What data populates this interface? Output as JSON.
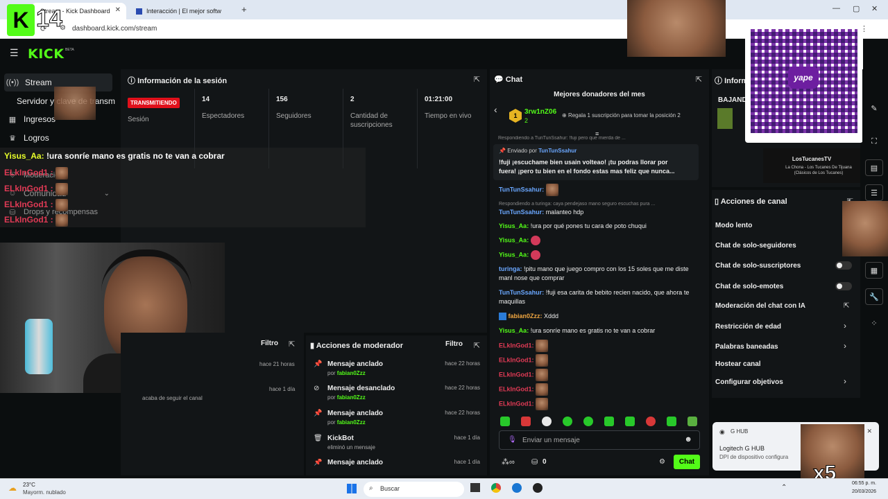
{
  "browser": {
    "tab1_title": "Stream - Kick Dashboard",
    "tab2_title": "Interacción | El mejor softw",
    "new_tab": "+",
    "url": "dashboard.kick.com/stream"
  },
  "app": {
    "logo": "KICK",
    "beta": "BETA"
  },
  "sidebar": {
    "items": [
      {
        "label": "Stream",
        "icon": "stream-icon"
      },
      {
        "label": "Servidor y clave de transm"
      },
      {
        "label": "Ingresos",
        "icon": "income-icon"
      },
      {
        "label": "Logros",
        "icon": "trophy-icon"
      },
      {
        "label": "Moderación",
        "icon": "shield-icon"
      },
      {
        "label": "Comunidad",
        "icon": "community-icon"
      },
      {
        "label": "Drops y recompensas",
        "icon": "gift-icon"
      }
    ]
  },
  "overlay": {
    "counter": "14",
    "line1_user": "Yisus_Aa:",
    "line1_text": "!ura sonríe mano es gratis no te van a cobrar",
    "elkin": "ELkInGod1 :",
    "follow_text": "acaba de seguir el canal"
  },
  "session": {
    "title": "Información de la sesión",
    "badge": "TRANSMITIENDO",
    "badge_label": "Sesión",
    "viewers": "14",
    "viewers_label": "Espectadores",
    "followers": "156",
    "followers_label": "Seguidores",
    "subs": "2",
    "subs_label": "Cantidad de suscripciones",
    "time": "01:21:00",
    "time_label": "Tiempo en vivo"
  },
  "left_lower": {
    "filter": "Filtro",
    "time1": "hace 21 horas",
    "time2": "hace 1 día"
  },
  "moderator": {
    "title": "Acciones de moderador",
    "filter": "Filtro",
    "rows": [
      {
        "title": "Mensaje anclado",
        "by_prefix": "por",
        "by": "fabian0Zzz",
        "time": "hace 22 horas"
      },
      {
        "title": "Mensaje desanclado",
        "by_prefix": "por",
        "by": "fabian0Zzz",
        "time": "hace 22 horas"
      },
      {
        "title": "Mensaje anclado",
        "by_prefix": "por",
        "by": "fabian0Zzz",
        "time": "hace 22 horas"
      },
      {
        "title": "KickBot",
        "by_prefix": "",
        "by": "eliminó un mensaje",
        "time": "hace 1 día"
      },
      {
        "title": "Mensaje anclado",
        "by_prefix": "",
        "by": "",
        "time": "hace 1 día"
      }
    ]
  },
  "chat": {
    "title": "Chat",
    "donors_title": "Mejores donadores del mes",
    "donor_name": "3rw1nZ06",
    "donor_count": "2",
    "donor_cta": "Regala 1 suscripción para tomar la posición 2",
    "reply1": "Respondiendo a TunTunSsahur: !fuji pero que mierda de ...",
    "pinned_by_label": "Enviado por",
    "pinned_by": "TunTunSsahur",
    "pinned_text": "!fuji ¡escuchame bien usain volteao! ¡tu podras llorar por fuera! ¡pero tu bien en el fondo estas mas feliz que nunca...",
    "reply2": "Respondiendo a turinga: caya pendejaso mano seguro escuchas pura ...",
    "messages": [
      {
        "user": "TunTunSsahur:",
        "text": ""
      },
      {
        "user": "TunTunSsahur:",
        "text": "malanteo hdp"
      },
      {
        "user": "Yisus_Aa:",
        "text": "!ura por qué pones tu cara de poto chuqui"
      },
      {
        "user": "Yisus_Aa:",
        "text": ""
      },
      {
        "user": "Yisus_Aa:",
        "text": ""
      },
      {
        "user": "turinga:",
        "text": "!pitu mano que juego compro con los 15 soles que me diste manl nose que comprar"
      },
      {
        "user": "TunTunSsahur:",
        "text": "!fuji esa carita de bebito recien nacido, que ahora te maquillas"
      },
      {
        "user": "fabian0Zzz:",
        "text": "Xddd"
      },
      {
        "user": "Yisus_Aa:",
        "text": "!ura sonríe mano es gratis no te van a cobrar"
      },
      {
        "user": "ELkInGod1:",
        "text": ""
      },
      {
        "user": "ELkInGod1:",
        "text": ""
      },
      {
        "user": "ELkInGod1:",
        "text": ""
      },
      {
        "user": "ELkInGod1:",
        "text": ""
      },
      {
        "user": "ELkInGod1:",
        "text": ""
      }
    ],
    "input_placeholder": "Enviar un mensaje",
    "points": "0",
    "send": "Chat"
  },
  "actions": {
    "info_title": "Inform",
    "banner_prefix": "BAJAND",
    "song_artist": "LosTucanesTV",
    "song_title": "La Chona - Los Tucanes De Tijuana (Clásicos de Los Tucanes)",
    "title": "Acciones de canal",
    "rows": [
      "Modo lento",
      "Chat de solo-seguidores",
      "Chat de solo-suscriptores",
      "Chat de solo-emotes",
      "Moderación del chat con IA",
      "Restricción de edad",
      "Palabras baneadas",
      "Hostear canal",
      "Configurar objetivos"
    ]
  },
  "notification": {
    "app": "G HUB",
    "title": "Logitech G HUB",
    "body": "DPI de dispositivo configura",
    "multiplier": "x5"
  },
  "taskbar": {
    "temp": "23°C",
    "weather": "Mayorm. nublado",
    "search": "Buscar",
    "time": "06:55 p. m.",
    "date": "20/03/2026"
  },
  "colors": {
    "accent": "#53fc18",
    "live": "#e0101b"
  }
}
